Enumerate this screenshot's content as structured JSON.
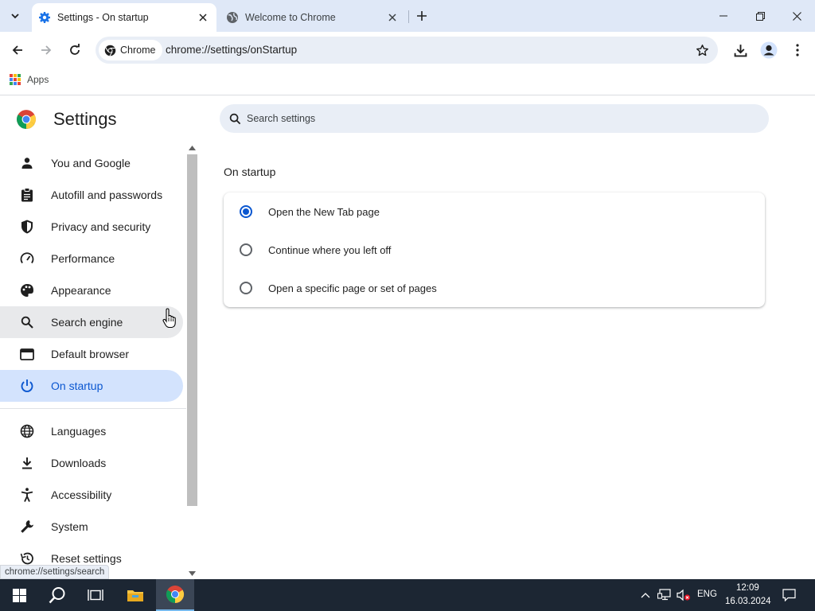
{
  "browser": {
    "tabs": [
      {
        "title": "Settings - On startup",
        "active": true
      },
      {
        "title": "Welcome to Chrome",
        "active": false
      }
    ],
    "omnibox": {
      "chip_label": "Chrome",
      "url": "chrome://settings/onStartup"
    },
    "bookmarks": {
      "apps_label": "Apps"
    },
    "status_url": "chrome://settings/search"
  },
  "settings": {
    "title": "Settings",
    "search_placeholder": "Search settings",
    "nav": [
      {
        "label": "You and Google",
        "icon": "person-icon"
      },
      {
        "label": "Autofill and passwords",
        "icon": "clipboard-icon"
      },
      {
        "label": "Privacy and security",
        "icon": "shield-icon"
      },
      {
        "label": "Performance",
        "icon": "gauge-icon"
      },
      {
        "label": "Appearance",
        "icon": "palette-icon"
      },
      {
        "label": "Search engine",
        "icon": "search-icon"
      },
      {
        "label": "Default browser",
        "icon": "browser-window-icon"
      },
      {
        "label": "On startup",
        "icon": "power-icon",
        "selected": true
      },
      {
        "label": "Languages",
        "icon": "globe-icon"
      },
      {
        "label": "Downloads",
        "icon": "download-icon"
      },
      {
        "label": "Accessibility",
        "icon": "accessibility-icon"
      },
      {
        "label": "System",
        "icon": "wrench-icon"
      },
      {
        "label": "Reset settings",
        "icon": "history-icon"
      }
    ],
    "section_title": "On startup",
    "options": [
      {
        "label": "Open the New Tab page",
        "checked": true
      },
      {
        "label": "Continue where you left off",
        "checked": false
      },
      {
        "label": "Open a specific page or set of pages",
        "checked": false
      }
    ]
  },
  "taskbar": {
    "language": "ENG",
    "time": "12:09",
    "date": "16.03.2024"
  },
  "colors": {
    "accent": "#0b57d0",
    "selected_bg": "#d3e3fd",
    "tabstrip_bg": "#dfe8f7",
    "taskbar_bg": "#1c2633"
  }
}
